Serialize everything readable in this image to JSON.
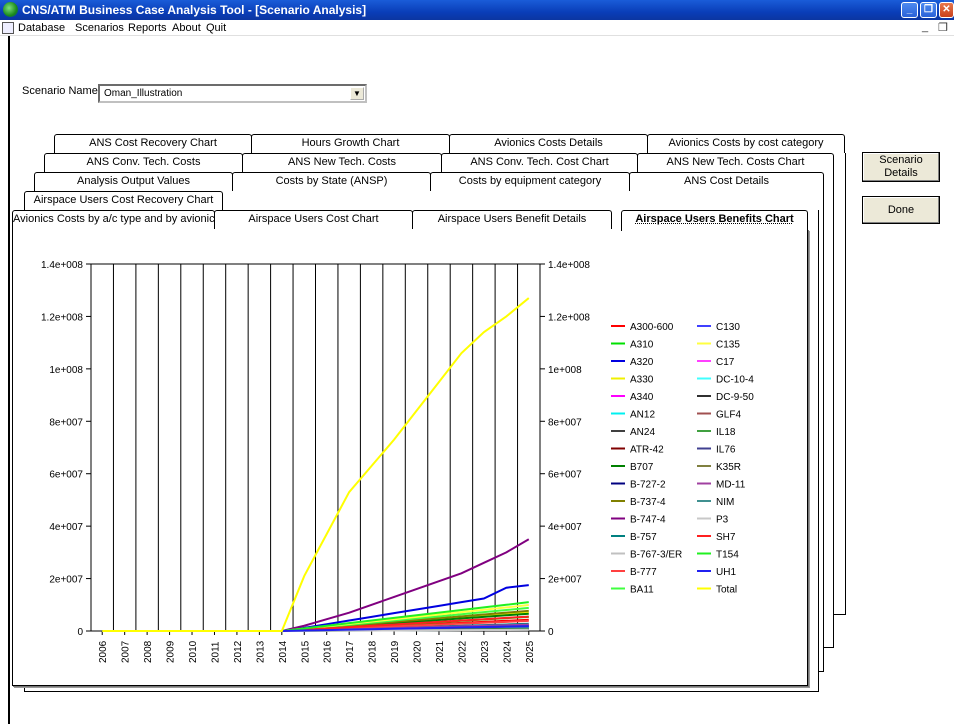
{
  "window": {
    "title": "CNS/ATM Business Case Analysis Tool - [Scenario Analysis]"
  },
  "menu": [
    "Database",
    "Scenarios",
    "Reports",
    "About",
    "Quit"
  ],
  "scenario": {
    "label": "Scenario Name:",
    "value": "Oman_Illustration"
  },
  "tabs": {
    "row1": [
      "ANS Cost Recovery Chart",
      "Hours Growth Chart",
      "Avionics Costs Details",
      "Avionics Costs by cost category"
    ],
    "row2": [
      "ANS Conv. Tech. Costs",
      "ANS New Tech. Costs",
      "ANS Conv. Tech. Cost Chart",
      "ANS New Tech. Costs Chart"
    ],
    "row3": [
      "Analysis Output Values",
      "Costs by State (ANSP)",
      "Costs by equipment category",
      "ANS Cost Details"
    ],
    "row4": [
      "Airspace Users Cost Recovery Chart"
    ],
    "row5": [
      "Avionics Costs by a/c type and by avionic",
      "Airspace Users Cost Chart",
      "Airspace Users Benefit Details",
      "Airspace Users Benefits Chart"
    ]
  },
  "buttons": {
    "scenario_details": "Scenario Details",
    "done": "Done"
  },
  "chart_data": {
    "type": "line",
    "categories": [
      "2006",
      "2007",
      "2008",
      "2009",
      "2010",
      "2011",
      "2012",
      "2013",
      "2014",
      "2015",
      "2016",
      "2017",
      "2018",
      "2019",
      "2020",
      "2021",
      "2022",
      "2023",
      "2024",
      "2025"
    ],
    "y_tick_labels": [
      "0",
      "2e+007",
      "4e+007",
      "6e+007",
      "8e+007",
      "1e+008",
      "1.2e+008",
      "1.4e+008"
    ],
    "ylim": [
      0,
      140000000
    ],
    "grid": "vertical",
    "legend_position": "right",
    "series": [
      {
        "name": "A300-600",
        "color": "#ff0000",
        "values": [
          0,
          0,
          0,
          0,
          0,
          0,
          0,
          0,
          0,
          300000,
          700000,
          1100000,
          1500000,
          1900000,
          2300000,
          2700000,
          3100000,
          3500000,
          3900000,
          4300000
        ]
      },
      {
        "name": "A310",
        "color": "#00e000",
        "values": [
          0,
          0,
          0,
          0,
          0,
          0,
          0,
          0,
          0,
          400000,
          900000,
          1400000,
          1900000,
          2400000,
          2900000,
          3400000,
          3900000,
          4400000,
          4900000,
          5400000
        ]
      },
      {
        "name": "A320",
        "color": "#0000e0",
        "values": [
          0,
          0,
          0,
          0,
          0,
          0,
          0,
          0,
          0,
          1200000,
          2600000,
          4000000,
          5400000,
          6800000,
          8200000,
          9600000,
          11000000,
          12400000,
          16500000,
          17500000
        ]
      },
      {
        "name": "A330",
        "color": "#f0f000",
        "values": [
          0,
          0,
          0,
          0,
          0,
          0,
          0,
          0,
          0,
          650000,
          1300000,
          1950000,
          2600000,
          3250000,
          3900000,
          4550000,
          5200000,
          5850000,
          6500000,
          7150000
        ]
      },
      {
        "name": "A340",
        "color": "#ff00ff",
        "values": [
          0,
          0,
          0,
          0,
          0,
          0,
          0,
          0,
          0,
          200000,
          400000,
          600000,
          800000,
          1000000,
          1200000,
          1400000,
          1600000,
          1800000,
          2000000,
          2200000
        ]
      },
      {
        "name": "AN12",
        "color": "#00f0f0",
        "values": [
          0,
          0,
          0,
          0,
          0,
          0,
          0,
          0,
          0,
          100000,
          200000,
          300000,
          400000,
          500000,
          600000,
          700000,
          800000,
          900000,
          1000000,
          1100000
        ]
      },
      {
        "name": "AN24",
        "color": "#404040",
        "values": [
          0,
          0,
          0,
          0,
          0,
          0,
          0,
          0,
          0,
          120000,
          240000,
          360000,
          480000,
          600000,
          720000,
          840000,
          960000,
          1080000,
          1200000,
          1320000
        ]
      },
      {
        "name": "ATR-42",
        "color": "#800000",
        "values": [
          0,
          0,
          0,
          0,
          0,
          0,
          0,
          0,
          0,
          90000,
          180000,
          270000,
          360000,
          450000,
          540000,
          630000,
          720000,
          810000,
          900000,
          990000
        ]
      },
      {
        "name": "B707",
        "color": "#008000",
        "values": [
          0,
          0,
          0,
          0,
          0,
          0,
          0,
          0,
          0,
          600000,
          1200000,
          1800000,
          2400000,
          3000000,
          3600000,
          4200000,
          4800000,
          5400000,
          6000000,
          6600000
        ]
      },
      {
        "name": "B-727-2",
        "color": "#000080",
        "values": [
          0,
          0,
          0,
          0,
          0,
          0,
          0,
          0,
          0,
          150000,
          300000,
          450000,
          600000,
          750000,
          900000,
          1050000,
          1200000,
          1350000,
          1500000,
          1650000
        ]
      },
      {
        "name": "B-737-4",
        "color": "#808000",
        "values": [
          0,
          0,
          0,
          0,
          0,
          0,
          0,
          0,
          0,
          700000,
          1400000,
          2100000,
          2800000,
          3500000,
          4200000,
          4900000,
          5600000,
          6300000,
          7000000,
          7700000
        ]
      },
      {
        "name": "B-747-4",
        "color": "#800080",
        "values": [
          0,
          0,
          0,
          0,
          0,
          0,
          0,
          0,
          0,
          2000000,
          4500000,
          7000000,
          10000000,
          13000000,
          16000000,
          19000000,
          22000000,
          26000000,
          30000000,
          35000000
        ]
      },
      {
        "name": "B-757",
        "color": "#008080",
        "values": [
          0,
          0,
          0,
          0,
          0,
          0,
          0,
          0,
          0,
          250000,
          500000,
          750000,
          1000000,
          1250000,
          1500000,
          1750000,
          2000000,
          2250000,
          2500000,
          2750000
        ]
      },
      {
        "name": "B-767-3/ER",
        "color": "#c0c0c0",
        "values": [
          0,
          0,
          0,
          0,
          0,
          0,
          0,
          0,
          0,
          180000,
          360000,
          540000,
          720000,
          900000,
          1080000,
          1260000,
          1440000,
          1620000,
          1800000,
          1980000
        ]
      },
      {
        "name": "B-777",
        "color": "#ff4040",
        "values": [
          0,
          0,
          0,
          0,
          0,
          0,
          0,
          0,
          0,
          350000,
          700000,
          1050000,
          1400000,
          1750000,
          2100000,
          2450000,
          2800000,
          3150000,
          3500000,
          3850000
        ]
      },
      {
        "name": "BA11",
        "color": "#40ff40",
        "values": [
          0,
          0,
          0,
          0,
          0,
          0,
          0,
          0,
          0,
          800000,
          1600000,
          2400000,
          3200000,
          4000000,
          4800000,
          5600000,
          6400000,
          7200000,
          8000000,
          8800000
        ]
      },
      {
        "name": "C130",
        "color": "#4040ff",
        "values": [
          0,
          0,
          0,
          0,
          0,
          0,
          0,
          0,
          0,
          130000,
          260000,
          390000,
          520000,
          650000,
          780000,
          910000,
          1040000,
          1170000,
          1300000,
          1430000
        ]
      },
      {
        "name": "C135",
        "color": "#ffff40",
        "values": [
          0,
          0,
          0,
          0,
          0,
          0,
          0,
          0,
          0,
          900000,
          1800000,
          2700000,
          3600000,
          4500000,
          5400000,
          6300000,
          7200000,
          8100000,
          9000000,
          9900000
        ]
      },
      {
        "name": "C17",
        "color": "#ff40ff",
        "values": [
          0,
          0,
          0,
          0,
          0,
          0,
          0,
          0,
          0,
          110000,
          220000,
          330000,
          440000,
          550000,
          660000,
          770000,
          880000,
          990000,
          1100000,
          1210000
        ]
      },
      {
        "name": "DC-10-4",
        "color": "#40ffff",
        "values": [
          0,
          0,
          0,
          0,
          0,
          0,
          0,
          0,
          0,
          140000,
          280000,
          420000,
          560000,
          700000,
          840000,
          980000,
          1120000,
          1260000,
          1400000,
          1540000
        ]
      },
      {
        "name": "DC-9-50",
        "color": "#303030",
        "values": [
          0,
          0,
          0,
          0,
          0,
          0,
          0,
          0,
          0,
          80000,
          160000,
          240000,
          320000,
          400000,
          480000,
          560000,
          640000,
          720000,
          800000,
          880000
        ]
      },
      {
        "name": "GLF4",
        "color": "#a05050",
        "values": [
          0,
          0,
          0,
          0,
          0,
          0,
          0,
          0,
          0,
          60000,
          120000,
          180000,
          240000,
          300000,
          360000,
          420000,
          480000,
          540000,
          600000,
          660000
        ]
      },
      {
        "name": "IL18",
        "color": "#40a040",
        "values": [
          0,
          0,
          0,
          0,
          0,
          0,
          0,
          0,
          0,
          70000,
          140000,
          210000,
          280000,
          350000,
          420000,
          490000,
          560000,
          630000,
          700000,
          770000
        ]
      },
      {
        "name": "IL76",
        "color": "#404090",
        "values": [
          0,
          0,
          0,
          0,
          0,
          0,
          0,
          0,
          0,
          160000,
          320000,
          480000,
          640000,
          800000,
          960000,
          1120000,
          1280000,
          1440000,
          1600000,
          1760000
        ]
      },
      {
        "name": "K35R",
        "color": "#808040",
        "values": [
          0,
          0,
          0,
          0,
          0,
          0,
          0,
          0,
          0,
          190000,
          380000,
          570000,
          760000,
          950000,
          1140000,
          1330000,
          1520000,
          1710000,
          1900000,
          2090000
        ]
      },
      {
        "name": "MD-11",
        "color": "#a040a0",
        "values": [
          0,
          0,
          0,
          0,
          0,
          0,
          0,
          0,
          0,
          220000,
          440000,
          660000,
          880000,
          1100000,
          1320000,
          1540000,
          1760000,
          1980000,
          2200000,
          2420000
        ]
      },
      {
        "name": "NIM",
        "color": "#409090",
        "values": [
          0,
          0,
          0,
          0,
          0,
          0,
          0,
          0,
          0,
          50000,
          100000,
          150000,
          200000,
          250000,
          300000,
          350000,
          400000,
          450000,
          500000,
          550000
        ]
      },
      {
        "name": "P3",
        "color": "#c8c8c8",
        "values": [
          0,
          0,
          0,
          0,
          0,
          0,
          0,
          0,
          0,
          40000,
          80000,
          120000,
          160000,
          200000,
          240000,
          280000,
          320000,
          360000,
          400000,
          440000
        ]
      },
      {
        "name": "SH7",
        "color": "#ff2020",
        "values": [
          0,
          0,
          0,
          0,
          0,
          0,
          0,
          0,
          0,
          500000,
          1000000,
          1500000,
          2000000,
          2500000,
          3000000,
          3500000,
          4000000,
          4500000,
          5000000,
          5500000
        ]
      },
      {
        "name": "T154",
        "color": "#20f020",
        "values": [
          0,
          0,
          0,
          0,
          0,
          0,
          0,
          0,
          0,
          1000000,
          2000000,
          3000000,
          4000000,
          5000000,
          6000000,
          7000000,
          8000000,
          9000000,
          10000000,
          11000000
        ]
      },
      {
        "name": "UH1",
        "color": "#2020f0",
        "values": [
          0,
          0,
          0,
          0,
          0,
          0,
          0,
          0,
          0,
          170000,
          340000,
          510000,
          680000,
          850000,
          1020000,
          1190000,
          1360000,
          1530000,
          1700000,
          1870000
        ]
      },
      {
        "name": "Total",
        "color": "#ffff00",
        "values": [
          0,
          0,
          0,
          0,
          0,
          0,
          0,
          0,
          0,
          21000000,
          37000000,
          53000000,
          63000000,
          73000000,
          84000000,
          95000000,
          106000000,
          114000000,
          120000000,
          127000000
        ]
      }
    ]
  }
}
